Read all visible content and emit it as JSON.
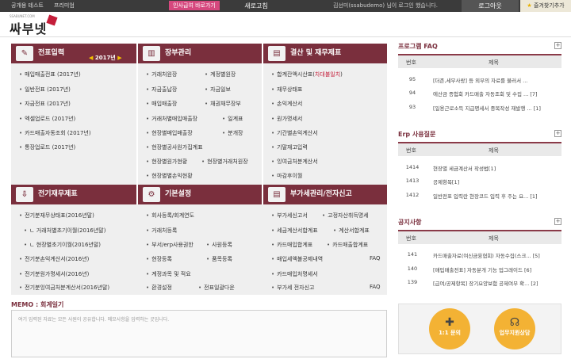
{
  "top": {
    "company": "공개용 테스트",
    "premium": "프리미엄",
    "pay_button": "인사급여 바로가기",
    "refresh": "새로고침",
    "greeting": "김선미(ssabudemo) 님이 로그인 했습니다.",
    "logout": "로그아웃",
    "favorite": "즐겨찾기추가"
  },
  "logo": {
    "text": "싸부넷",
    "tagline": "SSABUNET.COM"
  },
  "panels": {
    "p1": {
      "title": "전표입력",
      "year": "2017년",
      "items": [
        "매입매출전표 (2017년)",
        "일반전표 (2017년)",
        "자금전표 (2017년)",
        "엑셀업로드 (2017년)",
        "카드매출자동조회 (2017년)",
        "통장업로드 (2017년)"
      ]
    },
    "p2": {
      "title": "장부관리",
      "items_left": [
        "거래처원장",
        "자금출납장",
        "매입매출장",
        "거래처별매입매출장",
        "현장별매입매출장",
        "현장별공사원가집계표",
        "현장별원가현황",
        "현장별별손익현황"
      ],
      "items_right": [
        "계정별원장",
        "자금일보",
        "채권채무장부",
        "일계표",
        "분개장",
        "현장별거래처원장"
      ]
    },
    "p3": {
      "title": "결산 및 재무제표",
      "items": [
        "합계잔액시산표(",
        "차대불일치",
        ")",
        "재무상태표",
        "손익계산서",
        "원가명세서",
        "기간별손익계산서",
        "기말재고입력",
        "잉여금처분계산서",
        "마감후이월"
      ]
    },
    "p4": {
      "title": "전기재무제표",
      "items": [
        "전기분재무상태표(2016년말)",
        "ㄴ 거래처별초기이월(2016년말)",
        "ㄴ 현장별초기이월(2016년말)",
        "전기분손익계산서(2016년)",
        "전기분원가명세서(2016년)",
        "전기분잉여금처분계산서(2016년말)"
      ]
    },
    "p5": {
      "title": "기본설정",
      "items_left": [
        "회사등록/회계연도",
        "거래처등록",
        "부서/erp사용권한",
        "현장등록",
        "계정과목 및 적요",
        "환경설정"
      ],
      "items_right": [
        "사원등록",
        "품목등록",
        "전표일괄다운"
      ]
    },
    "p6": {
      "title": "부가세관리/전자신고",
      "items": [
        "부가세신고서",
        "고정자산취득명세",
        "세금계산서합계표",
        "계산서합계표",
        "카드매입합계표",
        "카드매출합계표",
        "매입세액불공제내역",
        "FAQ",
        "카드매입처명세서",
        "부가세 전자신고",
        "FAQ"
      ]
    }
  },
  "faq": {
    "title": "프로그램 FAQ",
    "col_num": "번호",
    "col_title": "제목",
    "rows": [
      {
        "num": "95",
        "title": "[더존,세무사랑] 등 외부의 자료를 불러서 ..."
      },
      {
        "num": "94",
        "title": "에산금 증험회 카드매출 자동조회 및 수집 ... [7]"
      },
      {
        "num": "93",
        "title": "[일용근로소득 지급명세서 중복작성 재발행 ... [1]"
      }
    ]
  },
  "erp": {
    "title": "Erp 사용질문",
    "col_num": "번호",
    "col_title": "제목",
    "rows": [
      {
        "num": "1414",
        "title": "현장별 세금계산서 작성법[1]"
      },
      {
        "num": "1413",
        "title": "공제항목[1]"
      },
      {
        "num": "1412",
        "title": "일반전표 입력란 현장코드 입력 후 주는 요... [1]"
      }
    ]
  },
  "notice": {
    "title": "공지사항",
    "col_num": "번호",
    "col_title": "제목",
    "rows": [
      {
        "num": "141",
        "title": "카드매출자료(여신금융협회) 자동수집(스크... [5]"
      },
      {
        "num": "140",
        "title": "[매입매출전표] 자동분개 기능 업그레이드 [6]"
      },
      {
        "num": "139",
        "title": "[급여/공제항목] 장기요양보험 공제여부 확... [2]"
      }
    ]
  },
  "memo": {
    "title": "MEMO : 회계일기",
    "placeholder": "여기 입력된 자료는 모든 사원이 공유합니다. 메모사항을 입력하는 곳입니다."
  },
  "cs": {
    "left": "1:1 문의",
    "right": "업무지원상담"
  },
  "colors": {
    "brand": "#7a2f3d",
    "accent": "#c41e3a",
    "pink_button": "#d6487e"
  }
}
